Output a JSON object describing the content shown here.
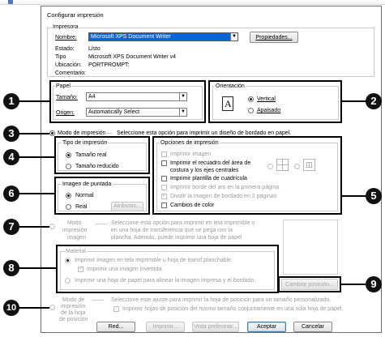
{
  "dialog": {
    "title": "Configurar impresión"
  },
  "printer": {
    "group_title": "Impresora",
    "name_label": "Nombre:",
    "name_value": "Microsoft XPS Document Writer",
    "properties_button": "Propiedades...",
    "status_label": "Estado:",
    "status_value": "Listo",
    "type_label": "Tipo",
    "type_value": "Microsoft XPS Document Writer v4",
    "location_label": "Ubicación:",
    "location_value": "PORTPROMPT:",
    "comment_label": "Comentario:"
  },
  "paper": {
    "group_title": "Papel",
    "size_label": "Tamaño:",
    "size_value": "A4",
    "source_label": "Origen:",
    "source_value": "Automatically Select"
  },
  "orientation": {
    "group_title": "Orientación",
    "page_icon": "A",
    "vertical": "Vertical",
    "landscape": "Apaisado"
  },
  "mode_print": {
    "label": "Modo de impresión",
    "description": "Seleccione esta opción para imprimir un diseño de bordado en papel."
  },
  "print_type": {
    "group_title": "Tipo de impresión",
    "real_size": "Tamaño real",
    "reduced_size": "Tamaño reducido"
  },
  "stitch_image": {
    "group_title": "Imagen de puntada",
    "normal": "Normal",
    "real": "Real",
    "attributes_button": "Atributos..."
  },
  "print_options": {
    "group_title": "Opciones de impresión",
    "print_image": "Imprimir imagen",
    "print_frame_line1": "Imprimir el recuadro del área de",
    "print_frame_line2": "costura y los ejes centrales",
    "print_grid": "Imprimir plantilla de cuadrícula",
    "print_hoop_edge": "Imprimir borde del aro en la primera página",
    "split_pages": "Dividir la imagen de bordado en 2 páginas",
    "color_changes": "Cambios de color"
  },
  "image_mode": {
    "label_line1": "Modo",
    "label_line2": "impresión",
    "label_line3": "imagen",
    "description_line1": "Seleccione esta opción para imprimir en tela imprimible o",
    "description_line2": "en una hoja de transferencia que se pega con la",
    "description_line3": "plancha. Además, puede imprimir una hoja de papel"
  },
  "material": {
    "group_title": "Material",
    "printable_fabric": "Imprimir imagen en tela imprimible u hoja de transf.planchable.",
    "mirror_image": "Imprimir una imagen invertida.",
    "align_sheet": "Imprimir una hoja de papel para alinear la imagen impresa y el bordado.",
    "change_position_button": "Cambiar posición..."
  },
  "position_sheet": {
    "label_line1": "Modo de",
    "label_line2": "impresión",
    "label_line3": "de la hoja",
    "label_line4": "de posición",
    "description": "Seleccione este ajuste para imprimir la hoja de posición para un tamaño personalizado.",
    "checkbox": "Imprimir hojas de posición del mismo tamaño conjuntamente en una sola hoja de papel."
  },
  "footer": {
    "network": "Red...",
    "print": "Imprimir...",
    "preview": "Vista preliminar...",
    "accept": "Aceptar",
    "cancel": "Cancelar"
  },
  "callouts": [
    "1",
    "2",
    "3",
    "4",
    "5",
    "6",
    "7",
    "8",
    "9",
    "10"
  ]
}
